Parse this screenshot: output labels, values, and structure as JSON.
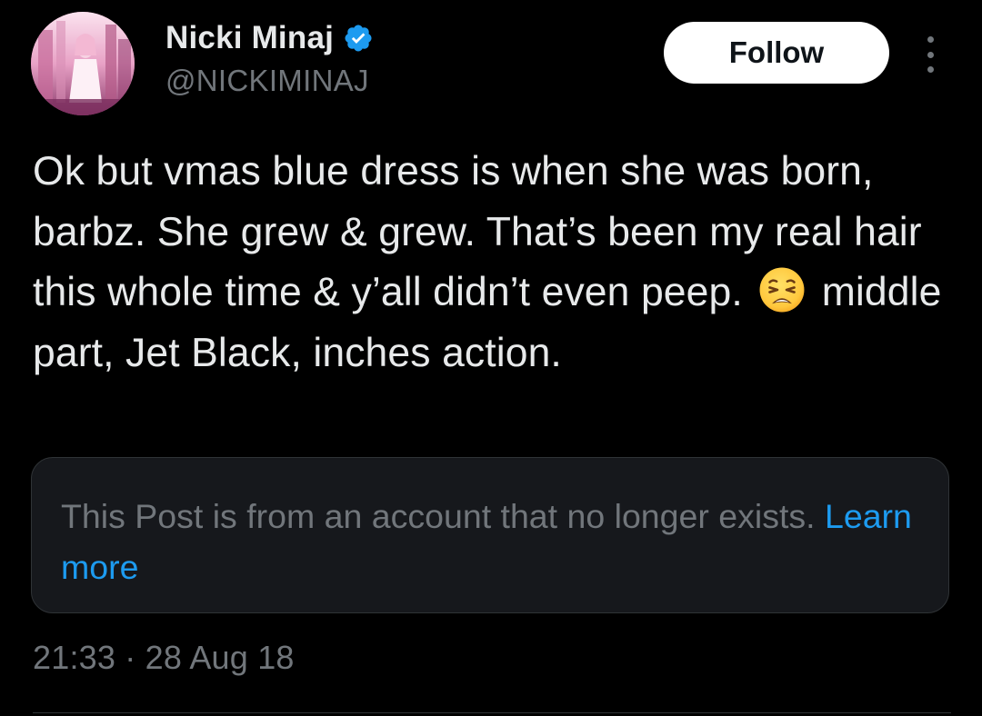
{
  "author": {
    "display_name": "Nicki Minaj",
    "handle": "@NICKIMINAJ",
    "verified": true,
    "avatar_icon": "profile-photo"
  },
  "actions": {
    "follow_label": "Follow",
    "more_icon": "more-vertical-icon"
  },
  "post": {
    "text_part1": "Ok but vmas blue dress is when she was born, barbz. She grew & grew. That’s been my real hair this whole time & y’all didn’t even peep.",
    "emoji": "weary-face-emoji",
    "text_part2": "middle part, Jet Black, inches action."
  },
  "notice": {
    "text": "This Post is from an account that no longer exists.",
    "link_label": "Learn more"
  },
  "meta": {
    "timestamp": "21:33 · 28 Aug 18"
  },
  "colors": {
    "background": "#000000",
    "text_primary": "#e7e9ea",
    "text_secondary": "#71767b",
    "accent_blue": "#1d9bf0",
    "notice_bg": "#16181c"
  }
}
